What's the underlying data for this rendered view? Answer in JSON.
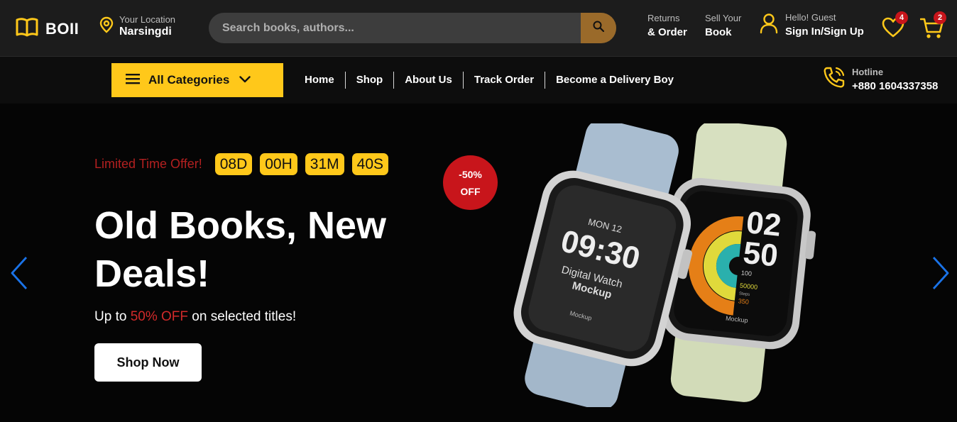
{
  "brand": {
    "name": "BOII"
  },
  "location": {
    "label": "Your Location",
    "value": "Narsingdi"
  },
  "search": {
    "placeholder": "Search books, authors..."
  },
  "header_links": {
    "returns": {
      "line1": "Returns",
      "line2": "& Order"
    },
    "sell": {
      "line1": "Sell Your",
      "line2": "Book"
    }
  },
  "account": {
    "greeting": "Hello! Guest",
    "action": "Sign In/Sign Up"
  },
  "wishlist": {
    "count": "4"
  },
  "cart": {
    "count": "2"
  },
  "nav": {
    "categories_label": "All Categories",
    "items": [
      "Home",
      "Shop",
      "About Us",
      "Track Order",
      "Become a Delivery Boy"
    ]
  },
  "hotline": {
    "label": "Hotline",
    "number": "+880 1604337358"
  },
  "hero": {
    "offer_label": "Limited Time Offer!",
    "countdown": [
      "08D",
      "00H",
      "31M",
      "40S"
    ],
    "title": "Old Books, New Deals!",
    "subtitle_prefix": "Up to ",
    "subtitle_highlight": "50% OFF",
    "subtitle_suffix": " on selected titles!",
    "cta": "Shop Now",
    "discount_line1": "-50%",
    "discount_line2": "OFF"
  },
  "watch_screen": {
    "date": "MON 12",
    "time": "09:30",
    "line1": "Digital Watch",
    "line2": "Mockup",
    "brand": "Mockup",
    "hours": "02",
    "minutes": "50",
    "stat1": "100",
    "stat2": "50000",
    "stat2_label": "Steps",
    "stat3": "350",
    "brand2": "Mockup"
  },
  "colors": {
    "accent": "#ffc81a",
    "red": "#c8151b",
    "search_btn": "#9a6a2a",
    "arrow": "#1a73e8"
  }
}
